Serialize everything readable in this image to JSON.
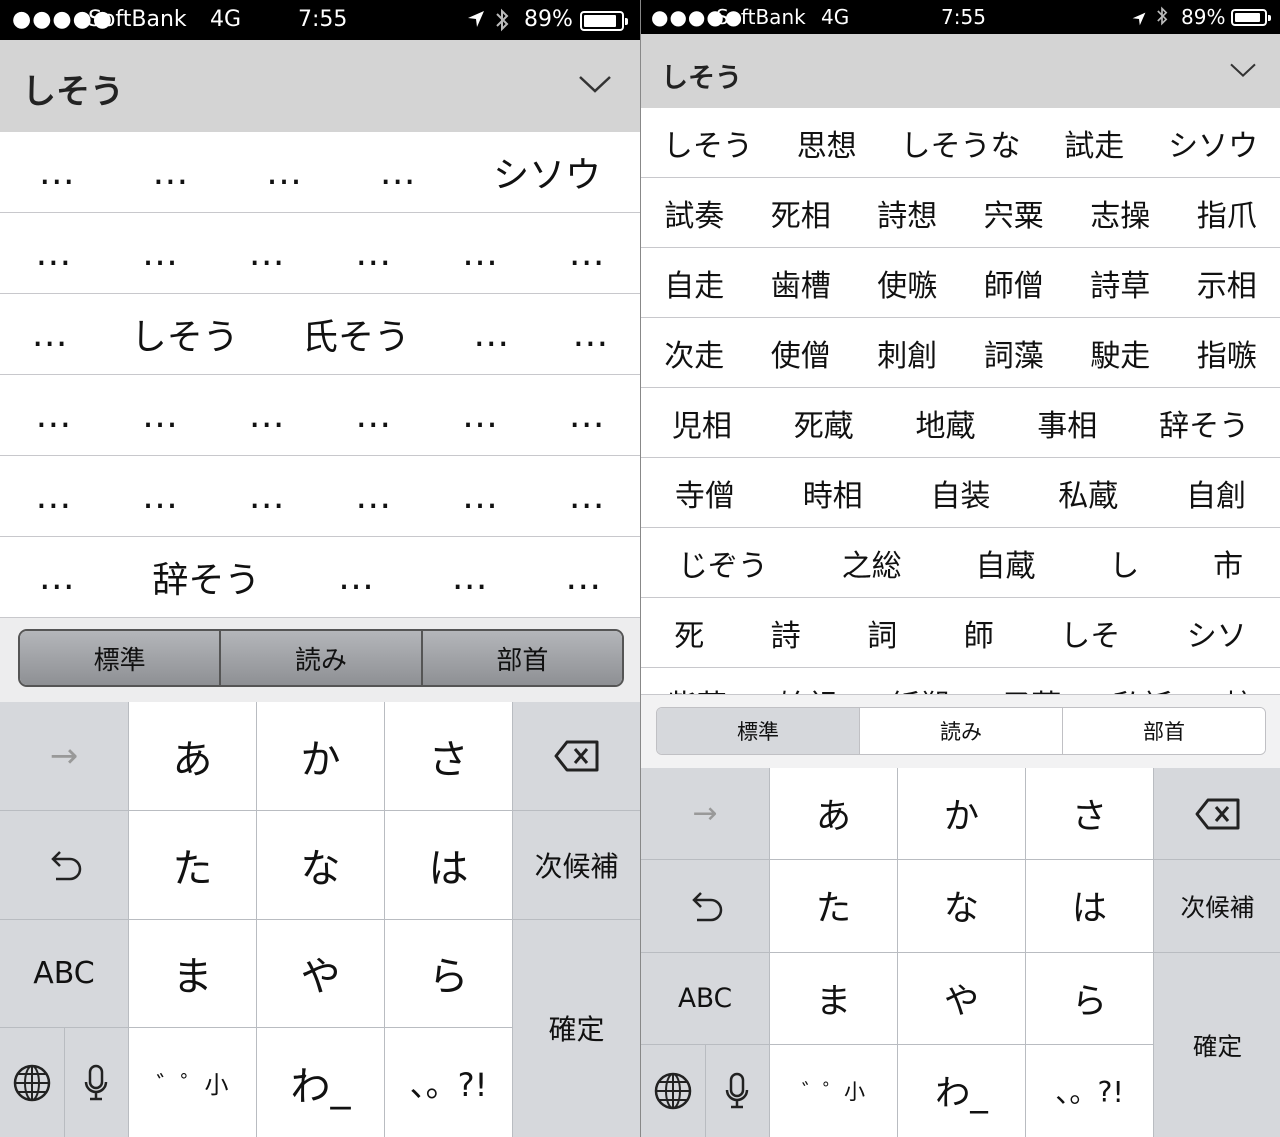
{
  "left": {
    "status": {
      "carrier": "SoftBank",
      "network": "4G",
      "time": "7:55",
      "battery": "89%",
      "battery_level": 0.89
    },
    "reading": "しそう",
    "candidate_rows": [
      [
        "…",
        "…",
        "…",
        "…",
        "シソウ"
      ],
      [
        "…",
        "…",
        "…",
        "…",
        "…",
        "…"
      ],
      [
        "…",
        "しそう",
        "氏そう",
        "…",
        "…"
      ],
      [
        "…",
        "…",
        "…",
        "…",
        "…",
        "…"
      ],
      [
        "…",
        "…",
        "…",
        "…",
        "…",
        "…"
      ],
      [
        "…",
        "辞そう",
        "…",
        "…",
        "…"
      ]
    ],
    "tabs": [
      "標準",
      "読み",
      "部首"
    ],
    "selected_tab": 0
  },
  "right": {
    "status": {
      "carrier": "SoftBank",
      "network": "4G",
      "time": "7:55",
      "battery": "89%",
      "battery_level": 0.89
    },
    "reading": "しそう",
    "candidate_rows": [
      [
        "しそう",
        "思想",
        "しそうな",
        "試走",
        "シソウ"
      ],
      [
        "試奏",
        "死相",
        "詩想",
        "宍粟",
        "志操",
        "指爪"
      ],
      [
        "自走",
        "歯槽",
        "使嗾",
        "師僧",
        "詩草",
        "示相"
      ],
      [
        "次走",
        "使僧",
        "刺創",
        "詞藻",
        "駛走",
        "指嗾"
      ],
      [
        "児相",
        "死蔵",
        "地蔵",
        "事相",
        "辞そう"
      ],
      [
        "寺僧",
        "時相",
        "自装",
        "私蔵",
        "自創"
      ],
      [
        "じぞう",
        "之総",
        "自蔵",
        "し",
        "市"
      ],
      [
        "死",
        "詩",
        "詞",
        "師",
        "しそ",
        "シソ"
      ],
      [
        "紫蘇",
        "始祖",
        "紙塑",
        "子葬",
        "私訴",
        "梓"
      ]
    ],
    "tabs": [
      "標準",
      "読み",
      "部首"
    ],
    "selected_tab": 0
  },
  "keyboard": {
    "next_arrow": "→",
    "undo": "↺",
    "abc": "ABC",
    "kana_rows": [
      [
        "あ",
        "か",
        "さ"
      ],
      [
        "た",
        "な",
        "は"
      ],
      [
        "ま",
        "や",
        "ら"
      ]
    ],
    "bottom": {
      "dakuten": "゛゜小",
      "wa": "わ_",
      "punct": "、。?!"
    },
    "next_candidate": "次候補",
    "confirm": "確定"
  },
  "icons": [
    "signal-dots-icon",
    "location-arrow-icon",
    "bluetooth-icon",
    "battery-icon",
    "chevron-down-icon",
    "backspace-icon",
    "undo-icon",
    "globe-icon",
    "microphone-icon"
  ],
  "colors": {
    "bar_bg": "#d4d4d4",
    "key_white": "#ffffff",
    "key_gray": "#d6d8dc",
    "divider": "#c8c8cc",
    "segment_dark": "#8e9094",
    "segment_selected_light": "#d6d8dc"
  }
}
